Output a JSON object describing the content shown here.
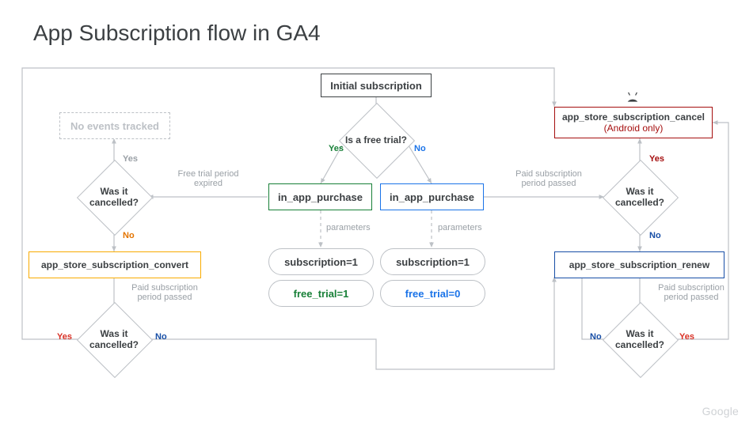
{
  "title": "App Subscription flow in GA4",
  "footer_logo": "Google",
  "nodes": {
    "initial": "Initial subscription",
    "free_trial_q": "Is a free trial?",
    "iap_yes": "in_app_purchase",
    "iap_no": "in_app_purchase",
    "sub1_yes": "subscription=1",
    "sub1_no": "subscription=1",
    "ft1": "free_trial=1",
    "ft0": "free_trial=0",
    "no_events": "No events tracked",
    "cancelled_q_tl": "Was it cancelled?",
    "cancelled_q_tr": "Was it cancelled?",
    "cancelled_q_bl": "Was it cancelled?",
    "cancelled_q_br": "Was it cancelled?",
    "convert": "app_store_subscription_convert",
    "renew": "app_store_subscription_renew",
    "cancel_line1": "app_store_subscription_cancel",
    "cancel_line2": "(Android only)"
  },
  "labels": {
    "yes": "Yes",
    "no": "No",
    "parameters": "parameters",
    "free_trial_expired": "Free trial period expired",
    "paid_passed": "Paid subscription period passed",
    "android_icon": "android"
  }
}
